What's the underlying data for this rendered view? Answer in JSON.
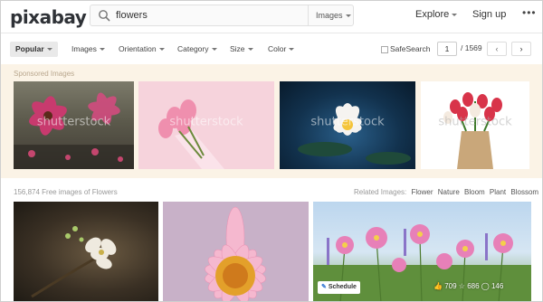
{
  "header": {
    "logo": "pixabay",
    "search_value": "flowers",
    "search_scope": "Images",
    "explore": "Explore",
    "signup": "Sign up",
    "more": "•••"
  },
  "filters": {
    "popular": "Popular",
    "images": "Images",
    "orientation": "Orientation",
    "category": "Category",
    "size": "Size",
    "color": "Color",
    "safesearch": "SafeSearch",
    "page_value": "1",
    "page_total": "/ 1569",
    "prev": "‹",
    "next": "›"
  },
  "sponsored": {
    "label": "Sponsored Images",
    "watermark": "shutterstock"
  },
  "results": {
    "count": "156,874 Free images of Flowers",
    "related_label": "Related Images:",
    "related_tags": [
      "Flower",
      "Nature",
      "Bloom",
      "Plant",
      "Blossom"
    ],
    "schedule": "Schedule",
    "likes": "709",
    "favorites": "686",
    "comments": "146"
  },
  "colors": {
    "sponsored_bg": "#fbf3e6",
    "text_dark": "#333333",
    "text_muted": "#999999"
  }
}
